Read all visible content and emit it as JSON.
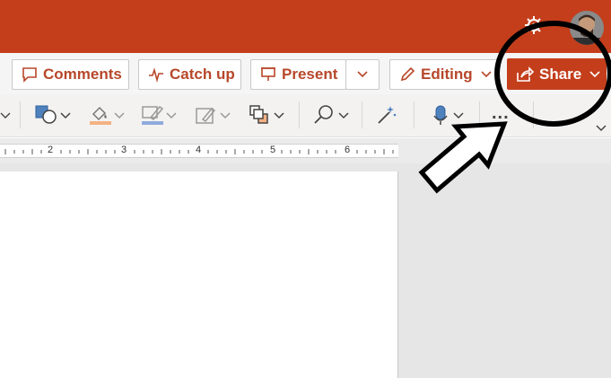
{
  "toolbar": {
    "comments_label": "Comments",
    "catchup_label": "Catch up",
    "present_label": "Present",
    "editing_label": "Editing",
    "share_label": "Share",
    "more_label": "..."
  },
  "ruler": {
    "numbers": [
      "2",
      "3",
      "4",
      "5",
      "6"
    ]
  },
  "colors": {
    "brand": "#c43e1c",
    "annotation": "#000000"
  },
  "icons": [
    "comment-icon",
    "activity-icon",
    "present-icon",
    "pencil-icon",
    "share-icon",
    "gear-icon",
    "shape-icon",
    "fill-icon",
    "outline-icon",
    "style-icon",
    "arrange-icon",
    "search-icon",
    "designer-icon",
    "dictate-icon",
    "chevron-down-icon"
  ]
}
